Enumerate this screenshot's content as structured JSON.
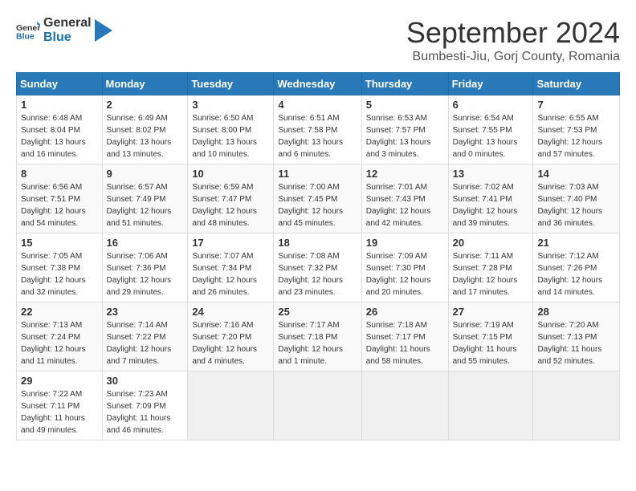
{
  "header": {
    "logo_general": "General",
    "logo_blue": "Blue",
    "month_title": "September 2024",
    "location": "Bumbesti-Jiu, Gorj County, Romania"
  },
  "days_of_week": [
    "Sunday",
    "Monday",
    "Tuesday",
    "Wednesday",
    "Thursday",
    "Friday",
    "Saturday"
  ],
  "weeks": [
    [
      {
        "day": "1",
        "sunrise": "6:48 AM",
        "sunset": "8:04 PM",
        "daylight": "13 hours and 16 minutes."
      },
      {
        "day": "2",
        "sunrise": "6:49 AM",
        "sunset": "8:02 PM",
        "daylight": "13 hours and 13 minutes."
      },
      {
        "day": "3",
        "sunrise": "6:50 AM",
        "sunset": "8:00 PM",
        "daylight": "13 hours and 10 minutes."
      },
      {
        "day": "4",
        "sunrise": "6:51 AM",
        "sunset": "7:58 PM",
        "daylight": "13 hours and 6 minutes."
      },
      {
        "day": "5",
        "sunrise": "6:53 AM",
        "sunset": "7:57 PM",
        "daylight": "13 hours and 3 minutes."
      },
      {
        "day": "6",
        "sunrise": "6:54 AM",
        "sunset": "7:55 PM",
        "daylight": "13 hours and 0 minutes."
      },
      {
        "day": "7",
        "sunrise": "6:55 AM",
        "sunset": "7:53 PM",
        "daylight": "12 hours and 57 minutes."
      }
    ],
    [
      {
        "day": "8",
        "sunrise": "6:56 AM",
        "sunset": "7:51 PM",
        "daylight": "12 hours and 54 minutes."
      },
      {
        "day": "9",
        "sunrise": "6:57 AM",
        "sunset": "7:49 PM",
        "daylight": "12 hours and 51 minutes."
      },
      {
        "day": "10",
        "sunrise": "6:59 AM",
        "sunset": "7:47 PM",
        "daylight": "12 hours and 48 minutes."
      },
      {
        "day": "11",
        "sunrise": "7:00 AM",
        "sunset": "7:45 PM",
        "daylight": "12 hours and 45 minutes."
      },
      {
        "day": "12",
        "sunrise": "7:01 AM",
        "sunset": "7:43 PM",
        "daylight": "12 hours and 42 minutes."
      },
      {
        "day": "13",
        "sunrise": "7:02 AM",
        "sunset": "7:41 PM",
        "daylight": "12 hours and 39 minutes."
      },
      {
        "day": "14",
        "sunrise": "7:03 AM",
        "sunset": "7:40 PM",
        "daylight": "12 hours and 36 minutes."
      }
    ],
    [
      {
        "day": "15",
        "sunrise": "7:05 AM",
        "sunset": "7:38 PM",
        "daylight": "12 hours and 32 minutes."
      },
      {
        "day": "16",
        "sunrise": "7:06 AM",
        "sunset": "7:36 PM",
        "daylight": "12 hours and 29 minutes."
      },
      {
        "day": "17",
        "sunrise": "7:07 AM",
        "sunset": "7:34 PM",
        "daylight": "12 hours and 26 minutes."
      },
      {
        "day": "18",
        "sunrise": "7:08 AM",
        "sunset": "7:32 PM",
        "daylight": "12 hours and 23 minutes."
      },
      {
        "day": "19",
        "sunrise": "7:09 AM",
        "sunset": "7:30 PM",
        "daylight": "12 hours and 20 minutes."
      },
      {
        "day": "20",
        "sunrise": "7:11 AM",
        "sunset": "7:28 PM",
        "daylight": "12 hours and 17 minutes."
      },
      {
        "day": "21",
        "sunrise": "7:12 AM",
        "sunset": "7:26 PM",
        "daylight": "12 hours and 14 minutes."
      }
    ],
    [
      {
        "day": "22",
        "sunrise": "7:13 AM",
        "sunset": "7:24 PM",
        "daylight": "12 hours and 11 minutes."
      },
      {
        "day": "23",
        "sunrise": "7:14 AM",
        "sunset": "7:22 PM",
        "daylight": "12 hours and 7 minutes."
      },
      {
        "day": "24",
        "sunrise": "7:16 AM",
        "sunset": "7:20 PM",
        "daylight": "12 hours and 4 minutes."
      },
      {
        "day": "25",
        "sunrise": "7:17 AM",
        "sunset": "7:18 PM",
        "daylight": "12 hours and 1 minute."
      },
      {
        "day": "26",
        "sunrise": "7:18 AM",
        "sunset": "7:17 PM",
        "daylight": "11 hours and 58 minutes."
      },
      {
        "day": "27",
        "sunrise": "7:19 AM",
        "sunset": "7:15 PM",
        "daylight": "11 hours and 55 minutes."
      },
      {
        "day": "28",
        "sunrise": "7:20 AM",
        "sunset": "7:13 PM",
        "daylight": "11 hours and 52 minutes."
      }
    ],
    [
      {
        "day": "29",
        "sunrise": "7:22 AM",
        "sunset": "7:11 PM",
        "daylight": "11 hours and 49 minutes."
      },
      {
        "day": "30",
        "sunrise": "7:23 AM",
        "sunset": "7:09 PM",
        "daylight": "11 hours and 46 minutes."
      },
      null,
      null,
      null,
      null,
      null
    ]
  ]
}
